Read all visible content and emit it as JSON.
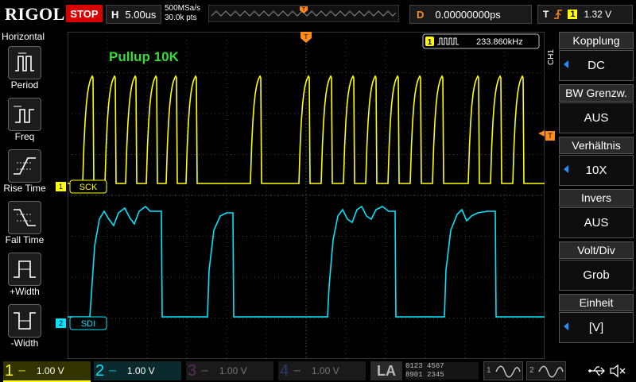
{
  "brand": "RIGOL",
  "run_state": "STOP",
  "horizontal": {
    "key": "H",
    "timebase": "5.00us",
    "sample_rate": "500MSa/s",
    "points": "30.0k pts"
  },
  "trigger_marker": "T",
  "delay": {
    "key": "D",
    "value": "0.00000000ps"
  },
  "trigger": {
    "key": "T",
    "channel": "1",
    "level": "1.32 V"
  },
  "left_menu": {
    "title": "Horizontal",
    "items": [
      {
        "label": "Period",
        "icon": "period-icon"
      },
      {
        "label": "Freq",
        "icon": "freq-icon"
      },
      {
        "label": "Rise Time",
        "icon": "rise-time-icon"
      },
      {
        "label": "Fall Time",
        "icon": "fall-time-icon"
      },
      {
        "label": "+Width",
        "icon": "pos-width-icon"
      },
      {
        "label": "-Width",
        "icon": "neg-width-icon"
      }
    ]
  },
  "annotation": "Pullup 10K",
  "measurement": {
    "channel": "1",
    "value": "233.860kHz"
  },
  "channel_labels": {
    "ch1_num": "1",
    "ch1": "SCK",
    "ch2_num": "2",
    "ch2": "SDI"
  },
  "right_menu": {
    "channel_tag": "CH1",
    "items": [
      {
        "title": "Kopplung",
        "value": "DC"
      },
      {
        "title": "BW Grenzw.",
        "value": "AUS"
      },
      {
        "title": "Verhältnis",
        "value": "10X"
      },
      {
        "title": "Invers",
        "value": "AUS"
      },
      {
        "title": "Volt/Div",
        "value": "Grob"
      },
      {
        "title": "Einheit",
        "value": "[V]"
      }
    ]
  },
  "bottom": {
    "channels": [
      {
        "num": "1",
        "value": "1.00 V",
        "color": "#ffff00"
      },
      {
        "num": "2",
        "value": "1.00 V",
        "color": "#00e5ff"
      },
      {
        "num": "3",
        "value": "1.00 V",
        "color": "#d040d0"
      },
      {
        "num": "4",
        "value": "1.00 V",
        "color": "#3a7bff"
      }
    ],
    "la": "LA",
    "la_bits": [
      "0123",
      "8901",
      "4567",
      "2345"
    ],
    "gen1": "1",
    "gen2": "2"
  },
  "colors": {
    "ch1": "#ffff00",
    "ch2": "#00e5ff",
    "trigger": "#ff8c1a",
    "accent": "#1e8fff",
    "annotation": "#33dd33"
  }
}
